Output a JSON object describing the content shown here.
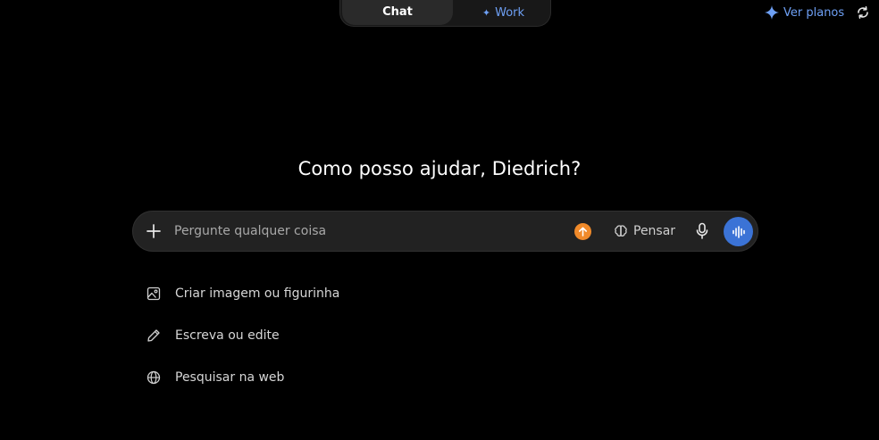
{
  "mode_switch": {
    "tabs": [
      {
        "label": "Chat",
        "active": true
      },
      {
        "label": "Work",
        "icon": "sparkle-icon",
        "active": false
      }
    ]
  },
  "top_right": {
    "plans_label": "Ver planos",
    "plans_icon": "sparkle-icon",
    "refresh_icon": "refresh-icon"
  },
  "heading": "Como posso ajudar, Diedrich?",
  "composer": {
    "placeholder": "Pergunte qualquer coisa",
    "value": "",
    "think_label": "Pensar"
  },
  "suggestions": [
    {
      "label": "Criar imagem ou figurinha",
      "icon": "image-icon"
    },
    {
      "label": "Escreva ou edite",
      "icon": "pencil-icon"
    },
    {
      "label": "Pesquisar na web",
      "icon": "globe-icon"
    }
  ],
  "colors": {
    "background": "#000000",
    "accent_blue": "#6ea0f5",
    "voice_button": "#3b73d6",
    "upload_dot": "#f08a2a",
    "composer_bg": "#222222"
  }
}
